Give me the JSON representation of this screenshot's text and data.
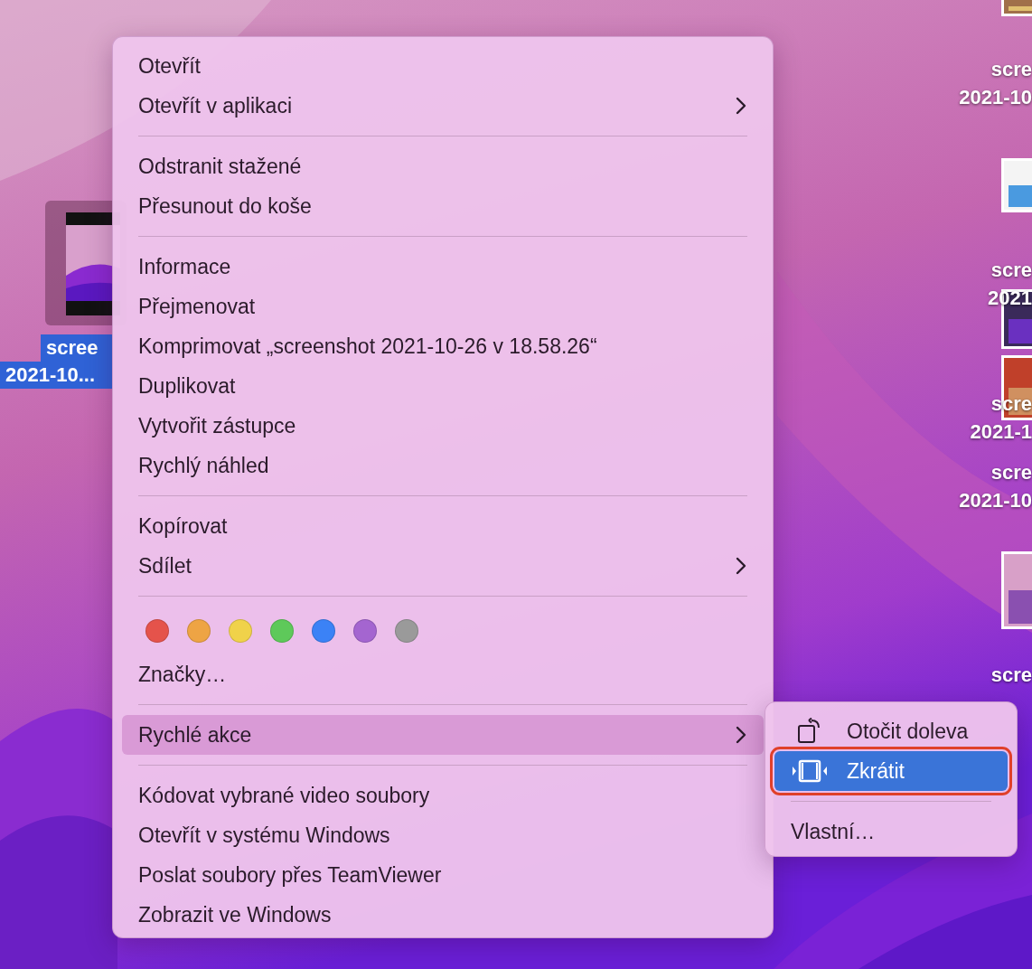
{
  "desktop": {
    "left_icon": {
      "selected": true,
      "label_lines": [
        "scree",
        "2021-10..."
      ]
    },
    "right_labels": [
      [
        "scre",
        "2021-10"
      ],
      [
        "scre",
        "2021"
      ],
      [
        "scre",
        "2021-1"
      ],
      [
        "scre",
        "2021-10"
      ],
      [
        "scre"
      ]
    ]
  },
  "context_menu": {
    "sections": [
      {
        "items": [
          {
            "kind": "item",
            "label": "Otevřít",
            "has_submenu": false,
            "selected": false
          },
          {
            "kind": "item",
            "label": "Otevřít v aplikaci",
            "has_submenu": true,
            "selected": false
          }
        ]
      },
      {
        "items": [
          {
            "kind": "item",
            "label": "Odstranit stažené",
            "has_submenu": false,
            "selected": false
          },
          {
            "kind": "item",
            "label": "Přesunout do koše",
            "has_submenu": false,
            "selected": false
          }
        ]
      },
      {
        "items": [
          {
            "kind": "item",
            "label": "Informace",
            "has_submenu": false,
            "selected": false
          },
          {
            "kind": "item",
            "label": "Přejmenovat",
            "has_submenu": false,
            "selected": false
          },
          {
            "kind": "item",
            "label": "Komprimovat „screenshot 2021-10-26 v 18.58.26“",
            "has_submenu": false,
            "selected": false
          },
          {
            "kind": "item",
            "label": "Duplikovat",
            "has_submenu": false,
            "selected": false
          },
          {
            "kind": "item",
            "label": "Vytvořit zástupce",
            "has_submenu": false,
            "selected": false
          },
          {
            "kind": "item",
            "label": "Rychlý náhled",
            "has_submenu": false,
            "selected": false
          }
        ]
      },
      {
        "items": [
          {
            "kind": "item",
            "label": "Kopírovat",
            "has_submenu": false,
            "selected": false
          },
          {
            "kind": "item",
            "label": "Sdílet",
            "has_submenu": true,
            "selected": false
          }
        ]
      },
      {
        "items": [
          {
            "kind": "tags",
            "tags": [
              {
                "color": "#e5534b"
              },
              {
                "color": "#eea444"
              },
              {
                "color": "#f0d24a"
              },
              {
                "color": "#5ec95a"
              },
              {
                "color": "#3b82f6"
              },
              {
                "color": "#a465d0"
              },
              {
                "color": "#9a9a9a"
              }
            ]
          },
          {
            "kind": "item",
            "label": "Značky…",
            "has_submenu": false,
            "selected": false
          }
        ]
      },
      {
        "items": [
          {
            "kind": "item",
            "label": "Rychlé akce",
            "has_submenu": true,
            "selected": true
          }
        ]
      },
      {
        "items": [
          {
            "kind": "item",
            "label": "Kódovat vybrané video soubory",
            "has_submenu": false,
            "selected": false
          },
          {
            "kind": "item",
            "label": "Otevřít v systému Windows",
            "has_submenu": false,
            "selected": false
          },
          {
            "kind": "item",
            "label": "Poslat soubory přes TeamViewer",
            "has_submenu": false,
            "selected": false
          },
          {
            "kind": "item",
            "label": "Zobrazit ve Windows",
            "has_submenu": false,
            "selected": false
          }
        ]
      }
    ]
  },
  "submenu": {
    "sections": [
      {
        "items": [
          {
            "kind": "rotate",
            "label": "Otočit doleva",
            "selected": false,
            "annotated": false
          },
          {
            "kind": "trim",
            "label": "Zkrátit",
            "selected": true,
            "annotated": true
          }
        ]
      },
      {
        "items": [
          {
            "kind": "item",
            "label": "Vlastní…",
            "selected": false,
            "annotated": false
          }
        ]
      }
    ]
  }
}
